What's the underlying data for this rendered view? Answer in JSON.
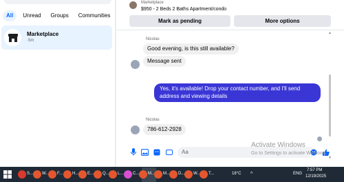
{
  "left": {
    "filters": [
      "All",
      "Unread",
      "Groups",
      "Communities"
    ],
    "conversation": {
      "name": "Marketplace",
      "time": "·5m",
      "icon": "storefront-icon"
    }
  },
  "chat": {
    "listing": {
      "source": "Marketplace",
      "title": "$950 - 2 Beds 2 Baths Apartment/condo",
      "mark_pending": "Mark as pending",
      "more_options": "More options"
    },
    "messages": [
      {
        "sender": "Nicolas",
        "text": "Good evening, is this still available?"
      },
      {
        "text": "Message sent"
      },
      {
        "text": "Yes, it's available! Drop your contact number, and I'll send address and viewing details",
        "outgoing": true
      },
      {
        "sender": "Nicolas",
        "text": "786-612-2928"
      }
    ],
    "composer": {
      "placeholder": "Aa"
    },
    "watermark": {
      "title": "Activate Windows",
      "subtitle": "Go to Settings to activate Windows."
    }
  },
  "taskbar": {
    "items": [
      "S...",
      "W...",
      "F...",
      "H...",
      "E...",
      "Q...",
      "L...",
      "C...",
      "M...",
      "M...",
      "D...",
      "W...",
      "T..."
    ],
    "temperature": "18°C",
    "language": "ENG",
    "time": "7:57 PM",
    "date": "12/19/2025"
  },
  "colors": {
    "accent": "#0866ff",
    "outgoing_bubble": "#3a36d6",
    "selected": "#e7f3ff"
  }
}
